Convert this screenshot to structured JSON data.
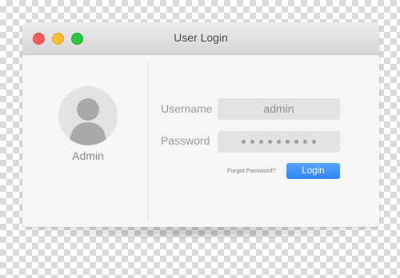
{
  "window": {
    "title": "User Login"
  },
  "user": {
    "name": "Admin",
    "avatar_icon": "person-silhouette-icon"
  },
  "form": {
    "username_label": "Username",
    "username_value": "admin",
    "password_label": "Password",
    "password_masked_dots": 9,
    "forgot_link": "Forgot Password?",
    "login_button": "Login"
  },
  "colors": {
    "accent": "#2d83f5",
    "close": "#fc5f57",
    "minimize": "#fdbc2e",
    "zoom": "#28c840"
  }
}
